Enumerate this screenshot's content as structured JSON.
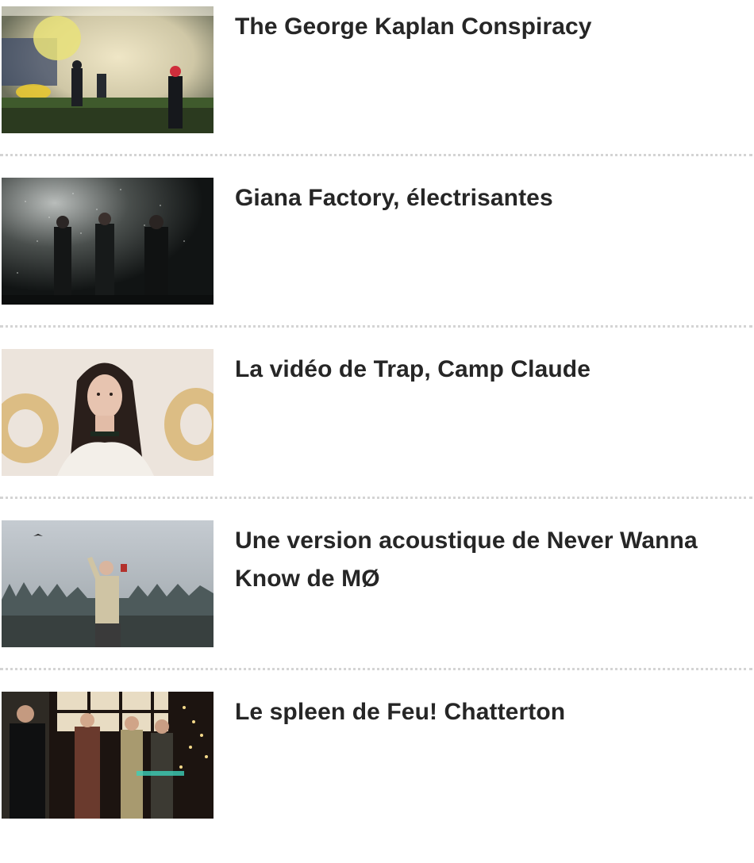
{
  "articles": [
    {
      "title": "The George Kaplan Conspiracy",
      "thumbnail": "band-smoke-photo"
    },
    {
      "title": "Giana Factory, électrisantes",
      "thumbnail": "band-night-photo"
    },
    {
      "title": "La vidéo de Trap, Camp Claude",
      "thumbnail": "portrait-photo"
    },
    {
      "title": "Une version acoustique de Never Wanna Know de MØ",
      "thumbnail": "singer-forest-photo"
    },
    {
      "title": "Le spleen de Feu! Chatterton",
      "thumbnail": "band-stage-photo"
    }
  ],
  "colors": {
    "title": "#262626",
    "separator": "#d4d4d4",
    "background": "#ffffff"
  }
}
